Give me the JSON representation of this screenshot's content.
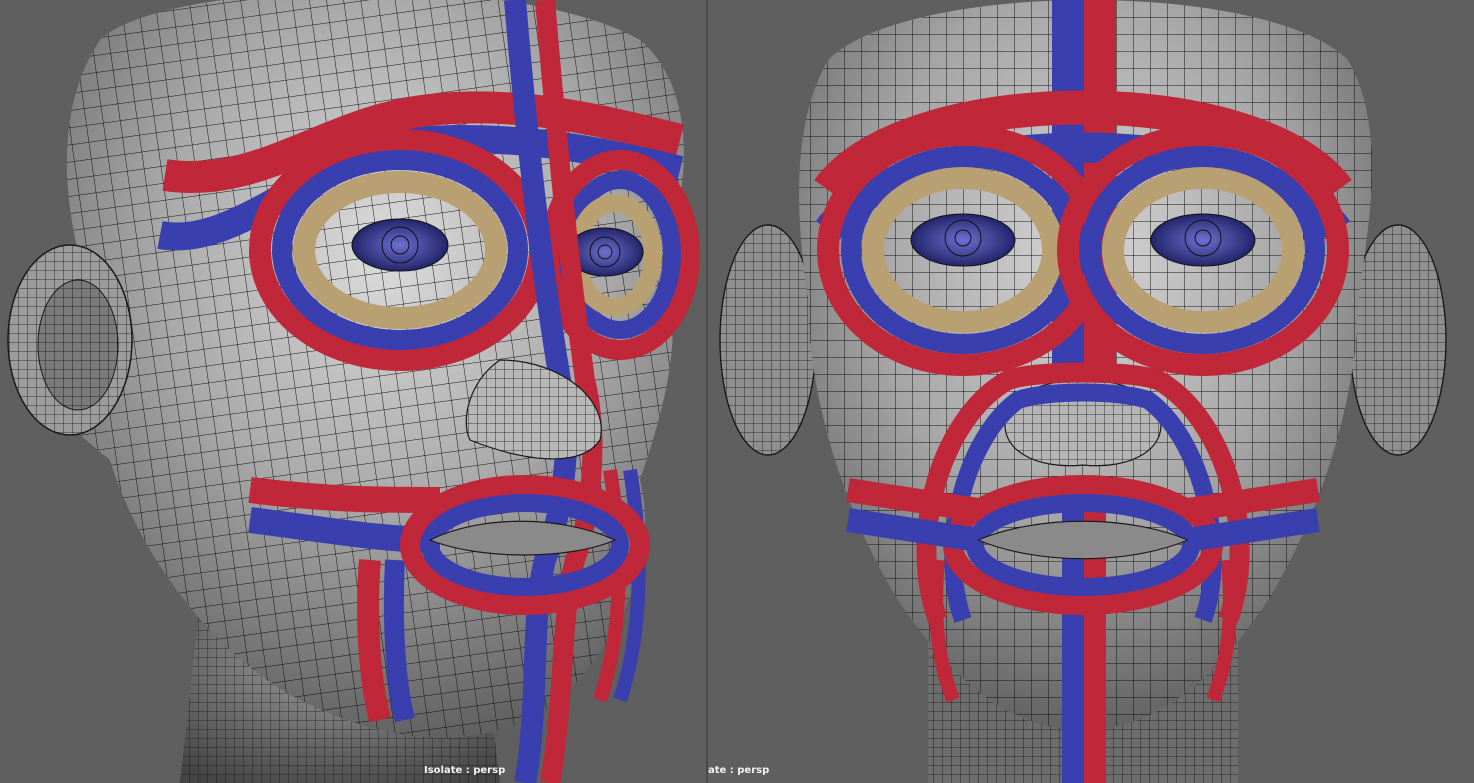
{
  "viewports": [
    {
      "name": "left",
      "view": "three-quarter",
      "camera_label": "Isolate : persp"
    },
    {
      "name": "right",
      "view": "front",
      "camera_label": "ate : persp"
    }
  ],
  "colors": {
    "background": "#5f5f5f",
    "skin_light": "#d8d8d8",
    "skin_shadow": "#555555",
    "wire": "#111111",
    "loop_red": "#c0283a",
    "loop_blue": "#3a3fb0",
    "loop_tan": "#b9a072",
    "eye_blue": "#3b3f9a",
    "label_text": "#f2f2f2"
  }
}
